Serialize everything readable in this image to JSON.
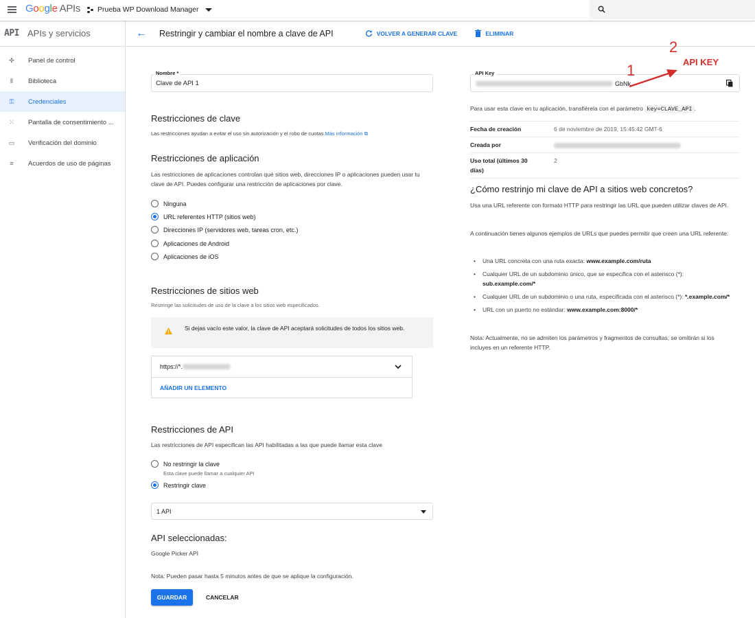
{
  "topbar": {
    "logo_google": "Google",
    "logo_apis": "APIs",
    "project": "Prueba WP Download Manager"
  },
  "sidebar": {
    "badge": "API",
    "title": "APIs y servicios",
    "items": [
      {
        "label": "Panel de control",
        "icon": "dashboard-icon"
      },
      {
        "label": "Biblioteca",
        "icon": "library-icon"
      },
      {
        "label": "Credenciales",
        "icon": "key-icon",
        "active": true
      },
      {
        "label": "Pantalla de consentimiento ...",
        "icon": "consent-icon"
      },
      {
        "label": "Verificación del dominio",
        "icon": "domain-icon"
      },
      {
        "label": "Acuerdos de uso de páginas",
        "icon": "settings-list-icon"
      }
    ]
  },
  "header": {
    "title": "Restringir y cambiar el nombre a clave de API",
    "regenerate": "VOLVER A GENERAR CLAVE",
    "delete": "ELIMINAR"
  },
  "form": {
    "name_label": "Nombre *",
    "name_value": "Clave de API 1",
    "key_restrictions_title": "Restricciones de clave",
    "key_restrictions_desc": "Las restricciones ayudan a evitar el uso sin autorización y el robo de cuotas.",
    "more_info": "Más información",
    "app_restrictions_title": "Restricciones de aplicación",
    "app_restrictions_desc": "Las restricciones de aplicaciones controlan qué sitios web, direcciones IP o aplicaciones pueden usar tu clave de API. Puedes configurar una restricción de aplicaciones por clave.",
    "app_options": [
      {
        "label": "Ninguna",
        "selected": false
      },
      {
        "label": "URL referentes HTTP (sitios web)",
        "selected": true
      },
      {
        "label": "Direcciones IP (servidores web, tareas cron, etc.)",
        "selected": false
      },
      {
        "label": "Aplicaciones de Android",
        "selected": false
      },
      {
        "label": "Aplicaciones de iOS",
        "selected": false
      }
    ],
    "web_title": "Restricciones de sitios web",
    "web_desc": "Restringe las solicitudes de uso de la clave a los sitios web especificados.",
    "warning": "Si dejas vacío este valor, la clave de API aceptará solicitudes de todos los sitios web.",
    "referer_value": "https://*.",
    "add_item": "AÑADIR UN ELEMENTO",
    "api_title": "Restricciones de API",
    "api_desc": "Las restricciones de API especifican las API habilitadas a las que puede llamar esta clave",
    "api_options": [
      {
        "label": "No restringir la clave",
        "sub": "Esta clave puede llamar a cualquier API",
        "selected": false
      },
      {
        "label": "Restringir clave",
        "sub": "",
        "selected": true
      }
    ],
    "api_select": "1 API",
    "selected_title": "API seleccionadas:",
    "selected_api": "Google Picker API",
    "note": "Nota: Pueden pasar hasta 5 minutos antes de que se aplique la configuración.",
    "save": "GUARDAR",
    "cancel": "CANCELAR"
  },
  "right": {
    "key_label": "API Key",
    "key_suffix": "GbNk",
    "usage_pre": "Para usar esta clave en tu aplicación, transfiérela con el parámetro",
    "usage_code": "key=CLAVE_API",
    "usage_post": ".",
    "meta": [
      {
        "k": "Fecha de creación",
        "v": "6 de noviembre de 2019, 15:45:42 GMT-6"
      },
      {
        "k": "Creada por",
        "v": ""
      },
      {
        "k": "Uso total (últimos 30 días)",
        "v": "2"
      }
    ],
    "how_title": "¿Cómo restrinjo mi clave de API a sitios web concretos?",
    "how_p1": "Usa una URL referente con formato HTTP para restringir las URL que pueden utilizar claves de API.",
    "how_p2": "A continuación tienes algunos ejemplos de URLs que puedes permitir que creen una URL referente:",
    "bullets": [
      {
        "text": "Una URL concreta con una ruta exacta: ",
        "bold": "www.example.com/ruta"
      },
      {
        "text": "Cualquier URL de un subdominio único, que se especifica con el asterisco (*): ",
        "bold": "sub.example.com/*"
      },
      {
        "text": "Cualquier URL de un subdominio o una ruta, especificada con el asterisco (*): ",
        "bold": "*.example.com/*"
      },
      {
        "text": "URL con un puerto no estándar: ",
        "bold": "www.example.com:8000/*"
      }
    ],
    "how_note": "Nota: Actualmente, no se admiten los parámetros y fragmentos de consultas; se omitirán si los incluyes en un referente HTTP."
  },
  "annotations": {
    "n1": "1",
    "n2": "2",
    "label": "API KEY",
    "color": "#d32f2f"
  }
}
